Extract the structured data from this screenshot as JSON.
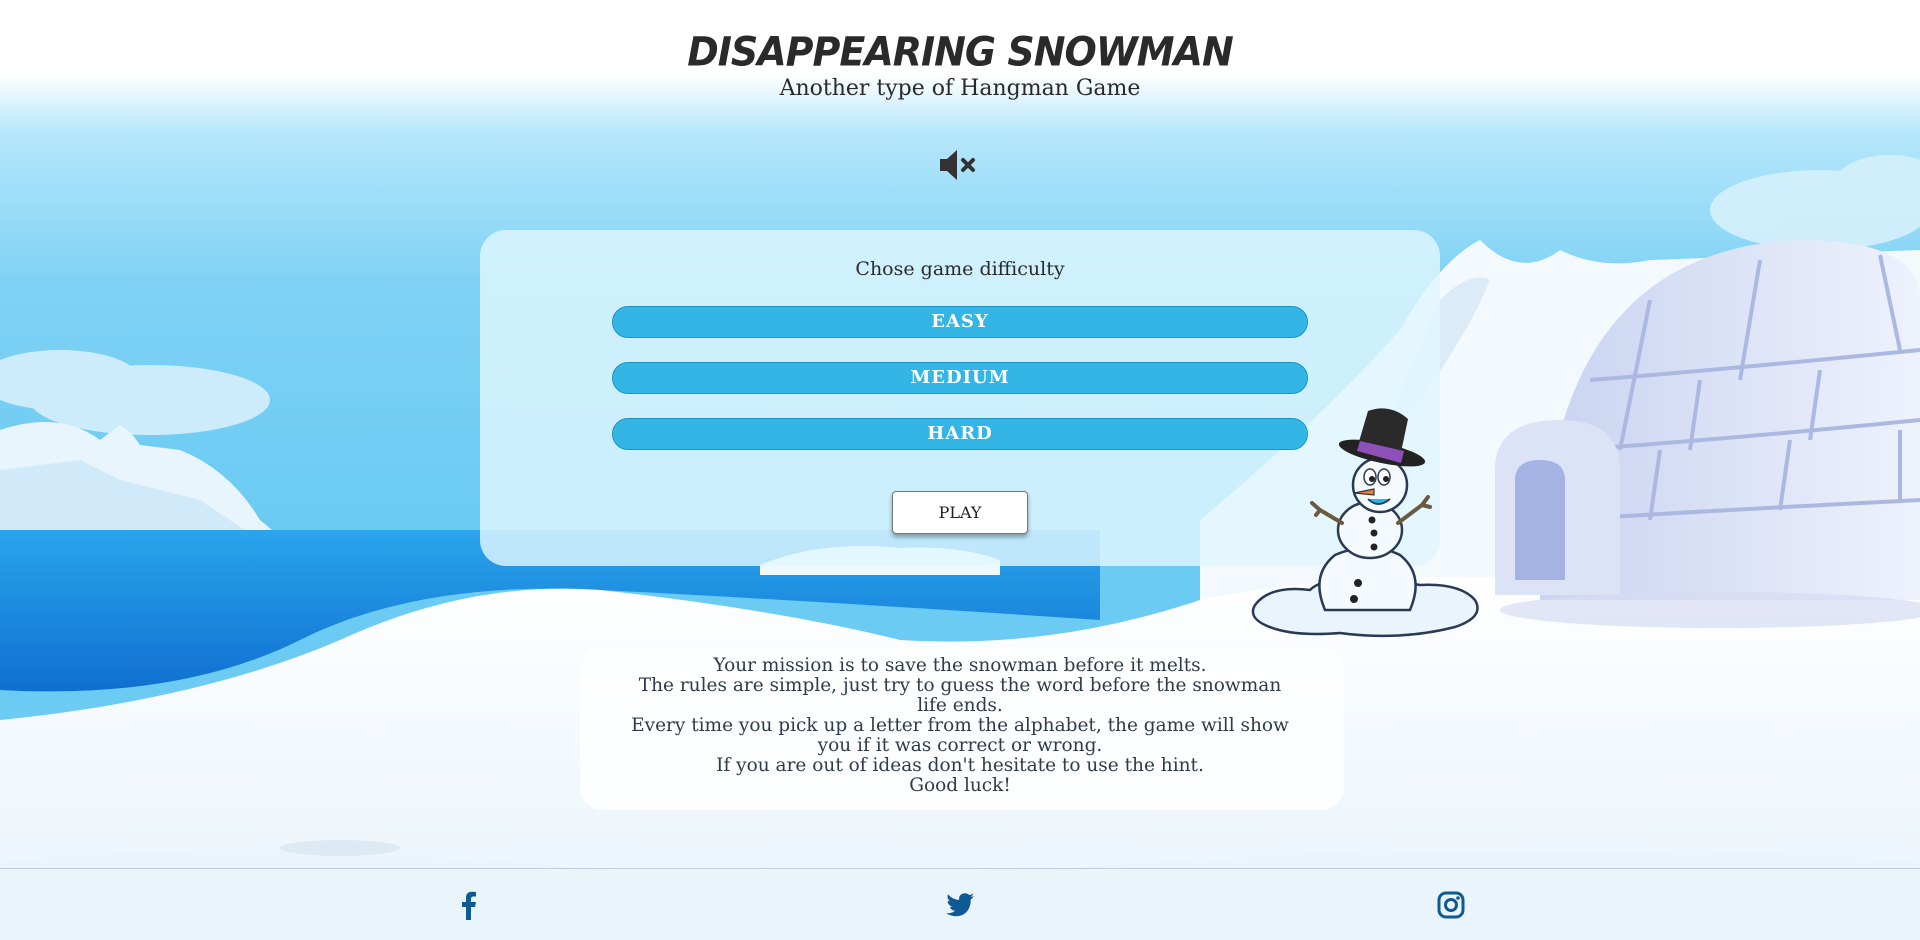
{
  "header": {
    "title": "DISAPPEARING SNOWMAN",
    "subtitle": "Another type of Hangman Game"
  },
  "sound": {
    "icon": "speaker-muted-icon",
    "muted": true
  },
  "difficulty": {
    "heading": "Chose game difficulty",
    "options": [
      {
        "label": "EASY"
      },
      {
        "label": "MEDIUM"
      },
      {
        "label": "HARD"
      }
    ],
    "play_label": "PLAY"
  },
  "rules": {
    "lines": [
      "Your mission is to save the snowman before it melts.",
      "The rules are simple, just try to guess the word before the snowman",
      "life ends.",
      "Every time you pick up a letter from the alphabet, the game will show",
      "you if it was correct or wrong.",
      "If you are out of ideas don't hesitate to use the hint.",
      "Good luck!"
    ]
  },
  "footer": {
    "links": [
      {
        "icon": "facebook-icon"
      },
      {
        "icon": "twitter-icon"
      },
      {
        "icon": "instagram-icon"
      }
    ]
  },
  "colors": {
    "sky_top": "#ffffff",
    "sky_mid": "#8fd8f8",
    "sky_bottom": "#5cc4f0",
    "water": "#1a8fe0",
    "button": "#33b5e5",
    "social": "#0e5b93",
    "title_text": "#2a2a2a"
  }
}
